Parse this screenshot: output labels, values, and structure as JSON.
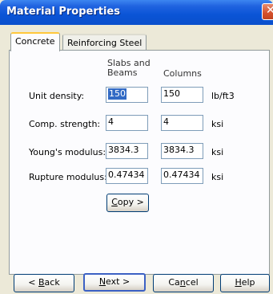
{
  "window": {
    "title": "Material Properties",
    "close_glyph": "✕"
  },
  "tabs": [
    {
      "label": "Concrete",
      "active": true
    },
    {
      "label": "Reinforcing Steel",
      "active": false
    }
  ],
  "columns": {
    "slabs_line1": "Slabs and",
    "slabs_line2": "Beams",
    "columns": "Columns"
  },
  "rows": [
    {
      "label": "Unit density:",
      "slabs": "150",
      "columns": "150",
      "unit": "lb/ft3"
    },
    {
      "label": "Comp. strength:",
      "slabs": "4",
      "columns": "4",
      "unit": "ksi"
    },
    {
      "label": "Young's modulus:",
      "slabs": "3834.3",
      "columns": "3834.3",
      "unit": "ksi"
    },
    {
      "label": "Rupture modulus:",
      "slabs": "0.47434",
      "columns": "0.47434",
      "unit": "ksi"
    }
  ],
  "copy_button": {
    "accel": "C",
    "rest": "opy >"
  },
  "footer": {
    "back": {
      "pre": "< ",
      "accel": "B",
      "rest": "ack"
    },
    "next": {
      "accel": "N",
      "rest": "ext >"
    },
    "cancel": {
      "pre": "Ca",
      "accel": "n",
      "rest": "cel"
    },
    "help": {
      "accel": "H",
      "rest": "elp"
    }
  },
  "colors": {
    "title_bar": "#0a54d6",
    "dialog_bg": "#ece9d8",
    "selection": "#316ac5"
  }
}
